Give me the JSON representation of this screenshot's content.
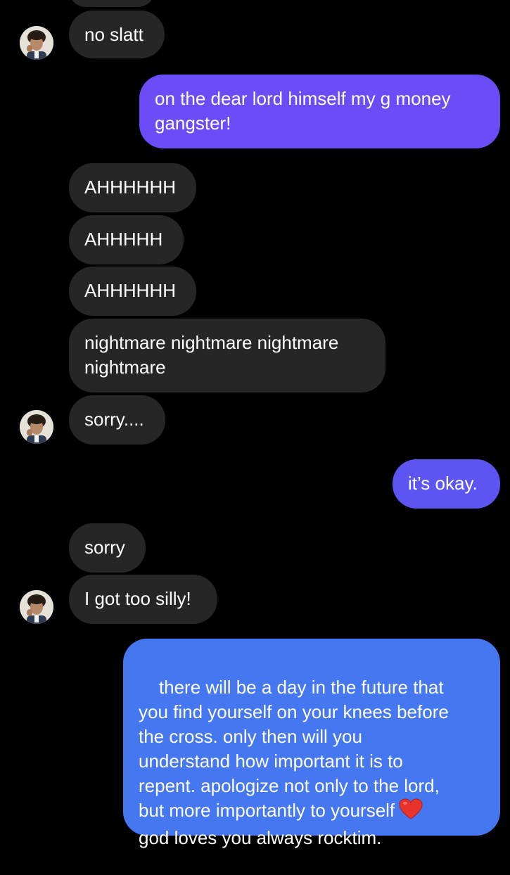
{
  "colors": {
    "background": "#000000",
    "incoming_bubble": "#262626",
    "outgoing_purple": "#6b4cf6",
    "outgoing_violet": "#5d55f2",
    "outgoing_blue": "#4577f0",
    "text": "#ffffff"
  },
  "messages": [
    {
      "sender": "them",
      "text": "no slatt",
      "avatar": true
    },
    {
      "sender": "me",
      "text": "on the dear lord himself my g money\ngangster!"
    },
    {
      "sender": "them",
      "text": "AHHHHHH"
    },
    {
      "sender": "them",
      "text": "AHHHHH"
    },
    {
      "sender": "them",
      "text": "AHHHHHH"
    },
    {
      "sender": "them",
      "text": "nightmare nightmare nightmare\nnightmare"
    },
    {
      "sender": "them",
      "text": "sorry....",
      "avatar": true
    },
    {
      "sender": "me",
      "text": "it’s okay."
    },
    {
      "sender": "them",
      "text": "sorry"
    },
    {
      "sender": "them",
      "text": "I got too silly!",
      "avatar": true
    },
    {
      "sender": "me",
      "text_before_emoji": "there will be a day in the future that\nyou find yourself on your knees before\nthe cross. only then will you\nunderstand how important it is to\nrepent. apologize not only to the lord,\nbut more importantly to yourself",
      "emoji": "red-heart-icon",
      "text_after_emoji": "god loves you always rocktim."
    }
  ]
}
